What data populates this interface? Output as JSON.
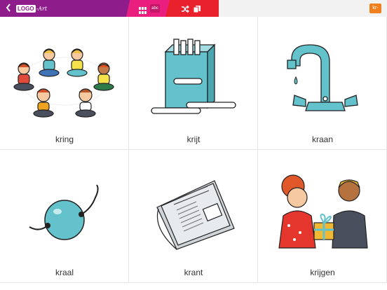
{
  "header": {
    "logo_box": "LOGO",
    "logo_art": "-Art",
    "abc_label": "abc",
    "language_label": "kr-"
  },
  "icons": {
    "back": "chevron-left-icon",
    "grid": "grid-icon",
    "shuffle": "shuffle-icon",
    "copy": "copy-icon"
  },
  "colors": {
    "purple": "#8e1d8b",
    "pink": "#e91e7f",
    "red": "#e8212d",
    "orange": "#f0801e",
    "illustration_blue": "#63c2cc"
  },
  "cards": [
    {
      "word": "kring",
      "image": "children-sitting-in-circle"
    },
    {
      "word": "krijt",
      "image": "box-of-chalk"
    },
    {
      "word": "kraan",
      "image": "water-tap"
    },
    {
      "word": "kraal",
      "image": "bead-on-string"
    },
    {
      "word": "krant",
      "image": "newspaper"
    },
    {
      "word": "krijgen",
      "image": "girl-receiving-gift"
    }
  ]
}
